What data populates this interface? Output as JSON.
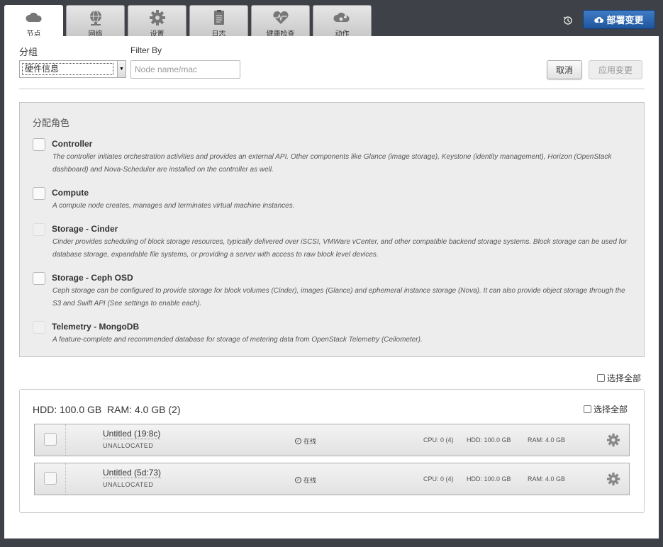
{
  "tabs": [
    {
      "label": "节点",
      "icon": "cloud-icon",
      "active": true
    },
    {
      "label": "网络",
      "icon": "network-globe-icon",
      "active": false
    },
    {
      "label": "设置",
      "icon": "gear-icon",
      "active": false
    },
    {
      "label": "日志",
      "icon": "clipboard-icon",
      "active": false
    },
    {
      "label": "健康检查",
      "icon": "heartbeat-icon",
      "active": false
    },
    {
      "label": "动作",
      "icon": "cloud-gears-icon",
      "active": false
    }
  ],
  "header": {
    "deploy_label": "部署变更",
    "deploy_icon": "cloud-upload-icon",
    "history_icon": "history-icon",
    "deploy_color": "#2a63ae"
  },
  "toolbar": {
    "group_label": "分组",
    "group_value": "硬件信息",
    "filter_label": "Filter By",
    "filter_placeholder": "Node name/mac",
    "cancel_label": "取消",
    "apply_label": "应用变更"
  },
  "roles": {
    "title": "分配角色",
    "items": [
      {
        "name": "Controller",
        "description": "The controller initiates orchestration activities and provides an external API. Other components like Glance (image storage), Keystone (identity management), Horizon (OpenStack dashboard) and Nova-Scheduler are installed on the controller as well.",
        "disabled": false
      },
      {
        "name": "Compute",
        "description": "A compute node creates, manages and terminates virtual machine instances.",
        "disabled": false
      },
      {
        "name": "Storage - Cinder",
        "description": "Cinder provides scheduling of block storage resources, typically delivered over iSCSI, VMWare vCenter, and other compatible backend storage systems. Block storage can be used for database storage, expandable file systems, or providing a server with access to raw block level devices.",
        "disabled": true
      },
      {
        "name": "Storage - Ceph OSD",
        "description": "Ceph storage can be configured to provide storage for block volumes (Cinder), images (Glance) and ephemeral instance storage (Nova). It can also provide object storage through the S3 and Swift API (See settings to enable each).",
        "disabled": false
      },
      {
        "name": "Telemetry - MongoDB",
        "description": "A feature-complete and recommended database for storage of metering data from OpenStack Telemetry (Ceilometer).",
        "disabled": true
      }
    ]
  },
  "select_all_label": "选择全部",
  "node_group": {
    "summary": "HDD: 100.0 GB  RAM: 4.0 GB (2)",
    "select_all_label": "选择全部",
    "nodes": [
      {
        "name": "Untitled (19:8c)",
        "status": "UNALLOCATED",
        "online": "在线",
        "cpu": "CPU: 0 (4)",
        "hdd": "HDD: 100.0 GB",
        "ram": "RAM: 4.0 GB"
      },
      {
        "name": "Untitled (5d:73)",
        "status": "UNALLOCATED",
        "online": "在线",
        "cpu": "CPU: 0 (4)",
        "hdd": "HDD: 100.0 GB",
        "ram": "RAM: 4.0 GB"
      }
    ]
  }
}
